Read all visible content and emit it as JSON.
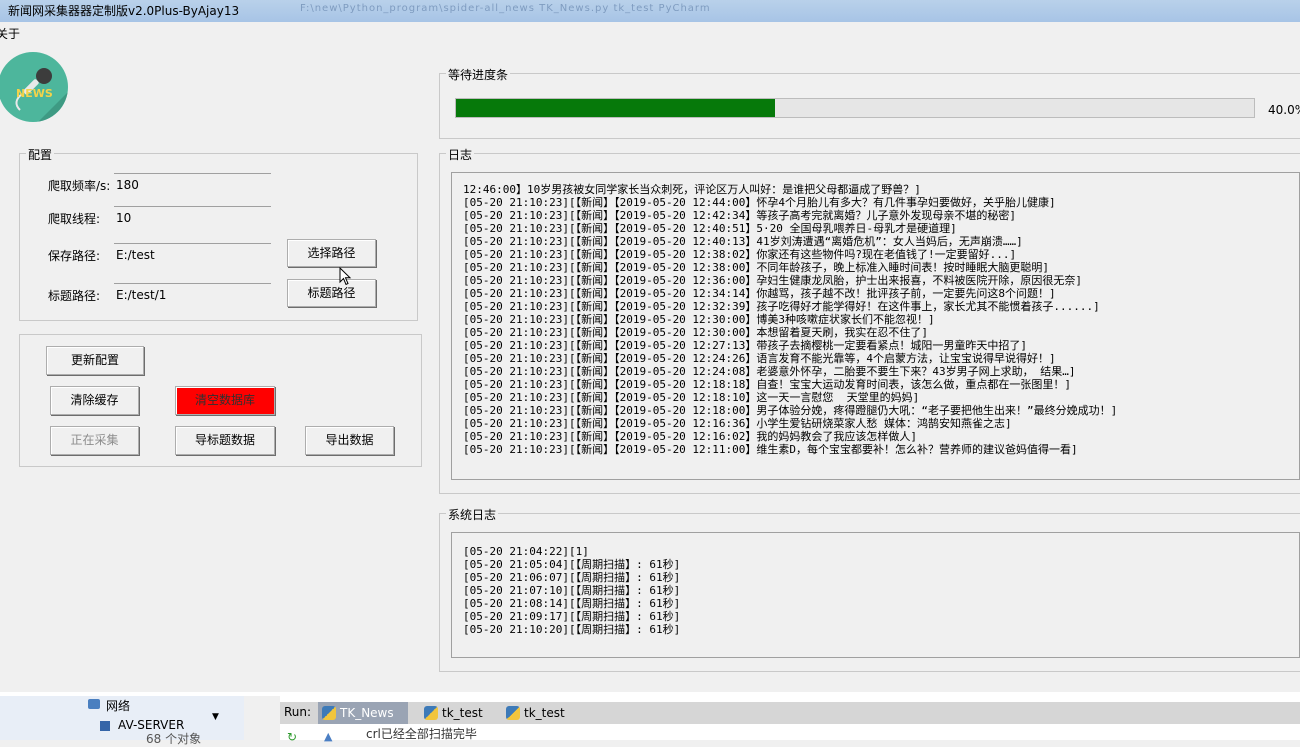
{
  "window": {
    "title": "新闻网采集器器定制版v2.0Plus-ByAjay13",
    "bg_title_text": "F:\\new\\Python_program\\spider-all_news  TK_News.py  tk_test  PyCharm"
  },
  "menu": {
    "about": "关于"
  },
  "logo": {
    "text": "NEWS",
    "icon": "microphone-news-logo"
  },
  "config": {
    "group_title": "配置",
    "frequency_label": "爬取频率/s:",
    "frequency_value": "180",
    "threads_label": "爬取线程:",
    "threads_value": "10",
    "save_path_label": "保存路径:",
    "save_path_value": "E:/test",
    "title_path_label": "标题路径:",
    "title_path_value": "E:/test/1",
    "choose_path_button": "选择路径",
    "title_path_button": "标题路径"
  },
  "actions": {
    "update_config": "更新配置",
    "clear_cache": "清除缓存",
    "clear_db": "清空数据库",
    "collecting": "正在采集",
    "export_titles": "导标题数据",
    "export_data": "导出数据"
  },
  "progress": {
    "group_title": "等待进度条",
    "value": 0.4,
    "label": "40.0%",
    "fill_color": "#06790a"
  },
  "log": {
    "group_title": "日志",
    "lines": [
      "12:46:00】10岁男孩被女同学家长当众刺死，评论区万人叫好：是谁把父母都逼成了野兽？]",
      "[05-20 21:10:23][【新闻】【2019-05-20 12:44:00】怀孕4个月胎儿有多大？有几件事孕妇要做好，关乎胎儿健康]",
      "[05-20 21:10:23][【新闻】【2019-05-20 12:42:34】等孩子高考完就离婚？儿子意外发现母亲不堪的秘密]",
      "[05-20 21:10:23][【新闻】【2019-05-20 12:40:51】5·20 全国母乳喂养日-母乳才是硬道理]",
      "[05-20 21:10:23][【新闻】【2019-05-20 12:40:13】41岁刘涛遭遇“离婚危机”：女人当妈后，无声崩溃……]",
      "[05-20 21:10:23][【新闻】【2019-05-20 12:38:02】你家还有这些物件吗?现在老值钱了!一定要留好...]",
      "[05-20 21:10:23][【新闻】【2019-05-20 12:38:00】不同年龄孩子，晚上标准入睡时间表！按时睡眠大脑更聪明]",
      "[05-20 21:10:23][【新闻】【2019-05-20 12:36:00】孕妇生健康龙凤胎，护士出来报喜，不料被医院开除，原因很无奈]",
      "[05-20 21:10:23][【新闻】【2019-05-20 12:34:14】你越骂，孩子越不改！批评孩子前，一定要先问这8个问题！]",
      "[05-20 21:10:23][【新闻】【2019-05-20 12:32:39】孩子吃得好才能学得好！在这件事上，家长尤其不能惯着孩子......]",
      "[05-20 21:10:23][【新闻】【2019-05-20 12:30:00】博美3种咳嗽症状家长们不能忽视！]",
      "[05-20 21:10:23][【新闻】【2019-05-20 12:30:00】本想留着夏天刷，我实在忍不住了]",
      "[05-20 21:10:23][【新闻】【2019-05-20 12:27:13】带孩子去摘樱桃一定要看紧点！城阳一男童昨天中招了]",
      "[05-20 21:10:23][【新闻】【2019-05-20 12:24:26】语言发育不能光靠等，4个启蒙方法，让宝宝说得早说得好！]",
      "[05-20 21:10:23][【新闻】【2019-05-20 12:24:08】老婆意外怀孕，二胎要不要生下来？43岁男子网上求助， 结果…]",
      "[05-20 21:10:23][【新闻】【2019-05-20 12:18:18】自查！宝宝大运动发育时间表，该怎么做，重点都在一张图里！]",
      "[05-20 21:10:23][【新闻】【2019-05-20 12:18:10】这一天一言慰您  天堂里的妈妈]",
      "[05-20 21:10:23][【新闻】【2019-05-20 12:18:00】男子体验分娩，疼得蹬腿仍大吼：“老子要把他生出来！”最终分娩成功！]",
      "[05-20 21:10:23][【新闻】【2019-05-20 12:16:36】小学生爱钻研烧菜家人愁 媒体：鸿鹄安知燕雀之志]",
      "[05-20 21:10:23][【新闻】【2019-05-20 12:16:02】我的妈妈教会了我应该怎样做人]",
      "[05-20 21:10:23][【新闻】【2019-05-20 12:11:00】维生素D，每个宝宝都要补！怎么补？营养师的建议爸妈值得一看]"
    ]
  },
  "syslog": {
    "group_title": "系统日志",
    "lines": [
      "[05-20 21:04:22][1]",
      "[05-20 21:05:04][【周期扫描】: 61秒]",
      "[05-20 21:06:07][【周期扫描】: 61秒]",
      "[05-20 21:07:10][【周期扫描】: 61秒]",
      "[05-20 21:08:14][【周期扫描】: 61秒]",
      "[05-20 21:09:17][【周期扫描】: 61秒]",
      "[05-20 21:10:20][【周期扫描】: 61秒]"
    ]
  },
  "taskbar": {
    "explorer_network": "网络",
    "explorer_server": "AV-SERVER",
    "explorer_count": "68 个对象",
    "run_label": "Run:",
    "run_tabs": [
      "TK_News",
      "tk_test",
      "tk_test"
    ],
    "console_text": "crl已经全部扫描完毕"
  }
}
